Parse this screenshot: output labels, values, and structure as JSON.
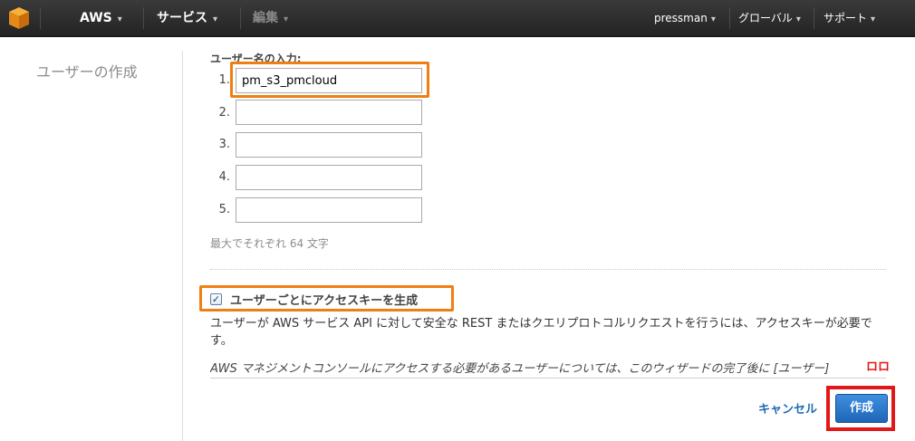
{
  "topbar": {
    "brand": "AWS",
    "services": "サービス",
    "edit": "編集",
    "username": "pressman",
    "region": "グローバル",
    "support": "サポート",
    "caret": "▾"
  },
  "page": {
    "title": "ユーザーの作成"
  },
  "users": {
    "label": "ユーザー名の入力:",
    "rows": [
      {
        "num": "1.",
        "value": "pm_s3_pmcloud"
      },
      {
        "num": "2.",
        "value": ""
      },
      {
        "num": "3.",
        "value": ""
      },
      {
        "num": "4.",
        "value": ""
      },
      {
        "num": "5.",
        "value": ""
      }
    ],
    "max_note": "最大でそれぞれ 64 文字"
  },
  "access_key": {
    "checked": true,
    "label": "ユーザーごとにアクセスキーを生成",
    "description": "ユーザーが AWS サービス API に対して安全な REST またはクエリプロトコルリクエストを行うには、アクセスキーが必要です。",
    "note": "AWS マネジメントコンソールにアクセスする必要があるユーザーについては、このウィザードの完了後に [ユーザー]",
    "note_overlay": "ロロ"
  },
  "actions": {
    "cancel": "キャンセル",
    "create": "作成"
  },
  "colors": {
    "highlight_orange": "#f07f12",
    "highlight_red": "#e21717",
    "primary_button": "#1e66b8",
    "link": "#1f6ab3"
  }
}
